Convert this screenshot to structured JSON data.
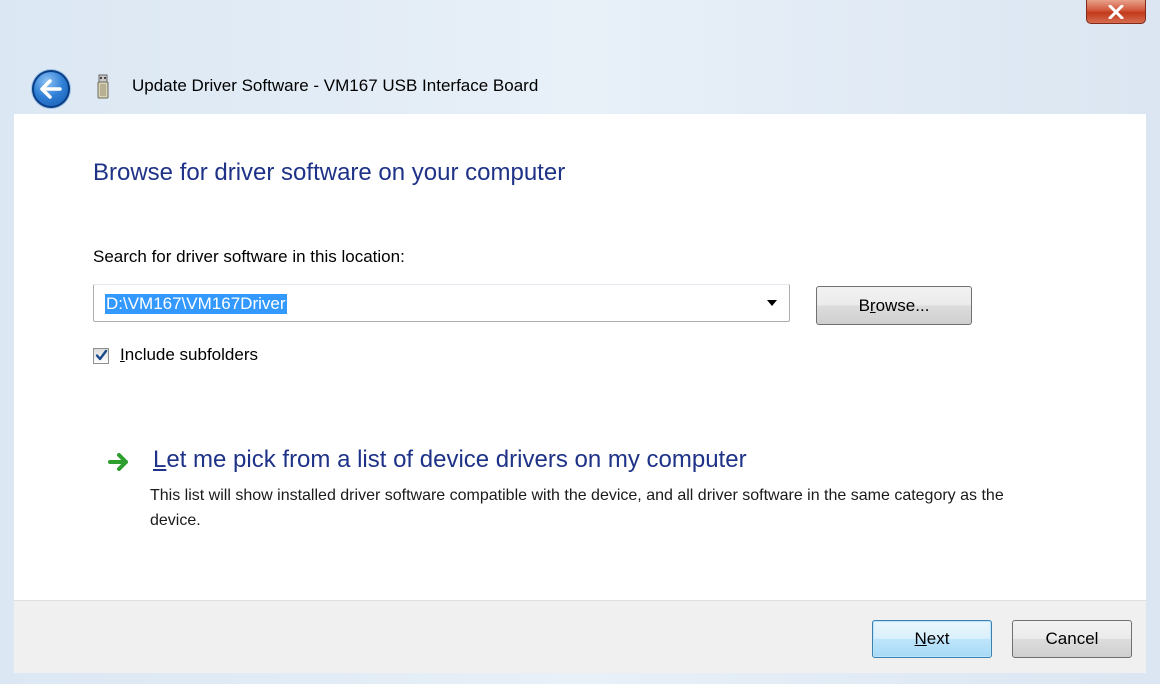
{
  "window": {
    "title": "Update Driver Software - VM167 USB Interface Board",
    "close_icon": "close-icon",
    "back_icon": "back-arrow-icon",
    "device_icon": "usb-device-icon"
  },
  "content": {
    "heading": "Browse for driver software on your computer",
    "search_label": "Search for driver software in this location:",
    "path_value": "D:\\VM167\\VM167Driver",
    "browse_button": {
      "pre": "B",
      "key": "r",
      "post": "owse..."
    },
    "include_subfolders": {
      "checked": true,
      "pre": "",
      "key": "I",
      "post": "nclude subfolders"
    },
    "pick_link": {
      "icon": "green-arrow-icon",
      "pre": "",
      "key": "L",
      "post": "et me pick from a list of device drivers on my computer"
    },
    "pick_description": "This list will show installed driver software compatible with the device, and all driver software in the same category as the device."
  },
  "footer": {
    "next_button": {
      "pre": "",
      "key": "N",
      "post": "ext"
    },
    "cancel_label": "Cancel"
  },
  "colors": {
    "heading_blue": "#1e3287",
    "selection_blue": "#3399ff",
    "close_red": "#c2391b"
  }
}
